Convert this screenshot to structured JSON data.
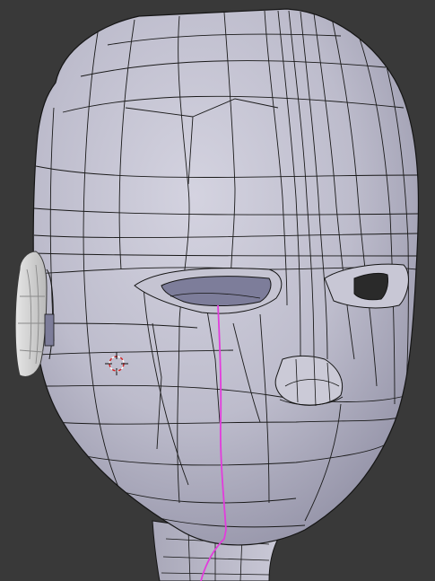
{
  "viewport": {
    "view": "3d-viewport",
    "mode": "edit-mode",
    "shading": "solid",
    "background_color": "#393939",
    "mesh_color": "#b7b6c6",
    "wire_color": "#151515",
    "seam_color": "#e23cdc",
    "cursor_color": "#d22222",
    "objects": [
      {
        "name": "head-mesh",
        "icon": "mesh-icon"
      },
      {
        "name": "ear-mesh",
        "icon": "mesh-icon"
      }
    ],
    "tools": [
      {
        "name": "3d-cursor",
        "icon": "crosshair-icon"
      }
    ]
  }
}
